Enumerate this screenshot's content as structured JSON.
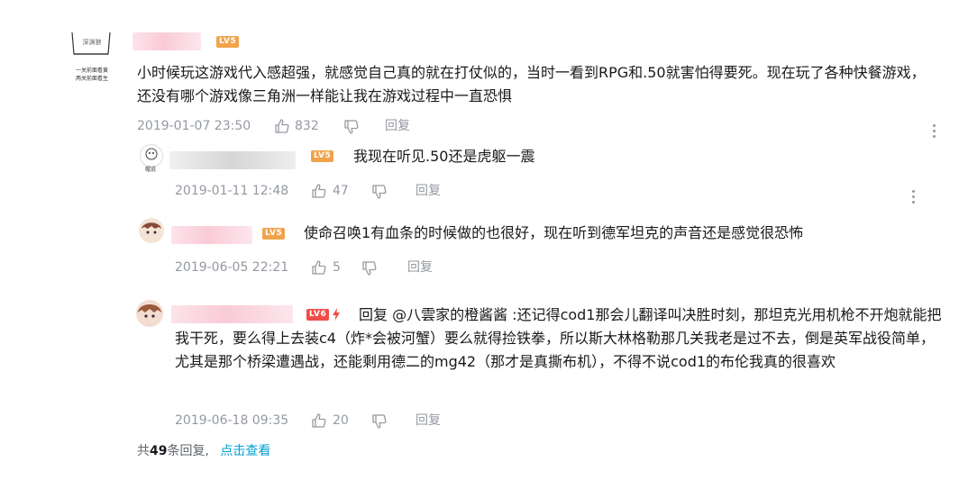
{
  "main_comment": {
    "level": "LV5",
    "text": "小时候玩这游戏代入感超强，就感觉自己真的就在打仗似的，当时一看到RPG和.50就害怕得要死。现在玩了各种快餐游戏，还没有哪个游戏像三角洲一样能让我在游戏过程中一直恐惧",
    "time": "2019-01-07 23:50",
    "likes": "832",
    "reply_label": "回复",
    "avatar_text": "深渊狼",
    "avatar_caption_1": "一关前面看黄",
    "avatar_caption_2": "两关前面看生"
  },
  "replies": [
    {
      "level": "LV5",
      "text": "我现在听见.50还是虎躯一震",
      "time": "2019-01-11 12:48",
      "likes": "47",
      "reply_label": "回复",
      "avatar_text": "帽说"
    },
    {
      "level": "LV5",
      "text": "使命召唤1有血条的时候做的也很好，现在听到德军坦克的声音还是感觉很恐怖",
      "time": "2019-06-05 22:21",
      "likes": "5",
      "reply_label": "回复"
    },
    {
      "level": "LV6",
      "text": "回复 @八雲家的橙酱酱 :还记得cod1那会儿翻译叫决胜时刻，那坦克光用机枪不开炮就能把我干死，要么得上去装c4（炸*会被河蟹）要么就得捡铁拳，所以斯大林格勒那几关我老是过不去，倒是英军战役简单，尤其是那个桥梁遭遇战，还能剩用德二的mg42（那才是真撕布机），不得不说cod1的布伦我真的很喜欢",
      "time": "2019-06-18 09:35",
      "likes": "20",
      "reply_label": "回复"
    }
  ],
  "footer": {
    "prefix": "共",
    "count": "49",
    "suffix": "条回复,",
    "view_link": "点击查看"
  },
  "icons": {
    "like": "thumbs-up-icon",
    "dislike": "thumbs-down-icon",
    "more": "more-vertical-icon"
  },
  "colors": {
    "text": "#18191c",
    "meta": "#9499a0",
    "link": "#00a1d6",
    "lv5": "#f0a34b",
    "lv6": "#f04c49"
  }
}
